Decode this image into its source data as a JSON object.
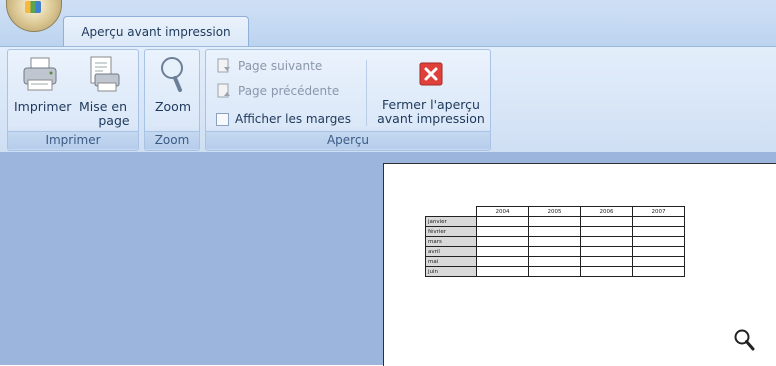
{
  "ribbon": {
    "active_tab": "Aperçu avant impression",
    "groups": {
      "imprimer": {
        "label": "Imprimer",
        "buttons": {
          "print": "Imprimer",
          "page_setup_line1": "Mise en",
          "page_setup_line2": "page"
        }
      },
      "zoom": {
        "label": "Zoom",
        "buttons": {
          "zoom": "Zoom"
        }
      },
      "apercu": {
        "label": "Aperçu",
        "next_page": "Page suivante",
        "prev_page": "Page précédente",
        "show_margins": "Afficher les marges",
        "show_margins_checked": false,
        "close_line1": "Fermer l'aperçu",
        "close_line2": "avant impression"
      }
    }
  },
  "sheet": {
    "columns": [
      "2004",
      "2005",
      "2006",
      "2007"
    ],
    "rows": [
      "janvier",
      "février",
      "mars",
      "avril",
      "mai",
      "juin"
    ]
  },
  "icons": {
    "print": "printer-icon",
    "page_setup": "page-setup-icon",
    "zoom": "magnifier-icon",
    "next_page": "page-next-icon",
    "prev_page": "page-prev-icon",
    "close": "close-red-x-icon",
    "cursor": "zoom-cursor-icon"
  },
  "colors": {
    "workspace_bg": "#9bb5dc",
    "ribbon_bg": "#dbe8f8",
    "close_button": "#e0403a"
  }
}
